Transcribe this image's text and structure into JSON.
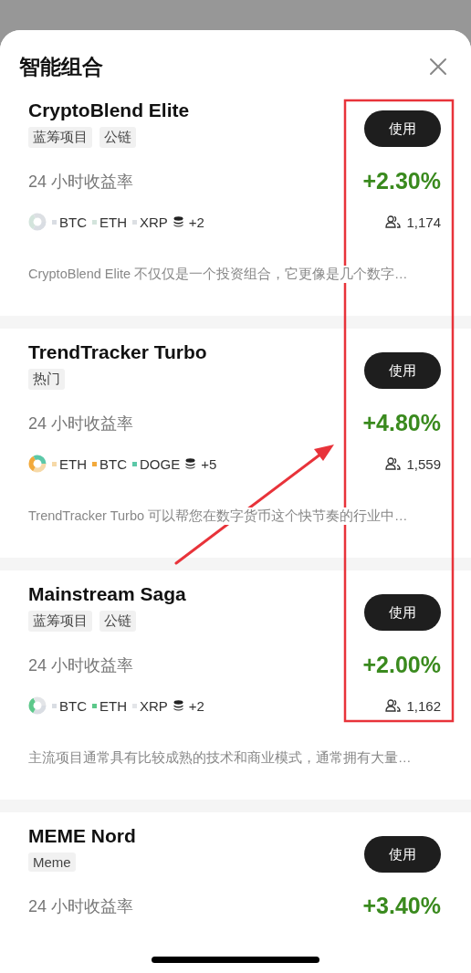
{
  "sheet": {
    "title": "智能组合"
  },
  "portfolios": [
    {
      "name": "CryptoBlend Elite",
      "tags": [
        "蓝筹项目",
        "公链"
      ],
      "button": "使用",
      "yield_label": "24 小时收益率",
      "yield": "+2.30%",
      "coins": [
        {
          "symbol": "BTC",
          "color": "#d9dde3"
        },
        {
          "symbol": "ETH",
          "color": "#d3e4dc"
        },
        {
          "symbol": "XRP",
          "color": "#dcdfe3"
        }
      ],
      "more": "+2",
      "users": "1,174",
      "description": "CryptoBlend Elite 不仅仅是一个投资组合，它更像是几个数字…"
    },
    {
      "name": "TrendTracker Turbo",
      "tags": [
        "热门"
      ],
      "button": "使用",
      "yield_label": "24 小时收益率",
      "yield": "+4.80%",
      "coins": [
        {
          "symbol": "ETH",
          "color": "#f6d9a8"
        },
        {
          "symbol": "BTC",
          "color": "#f2a93b"
        },
        {
          "symbol": "DOGE",
          "color": "#5cc8a8"
        }
      ],
      "more": "+5",
      "users": "1,559",
      "description": "TrendTracker Turbo 可以帮您在数字货币这个快节奏的行业中…"
    },
    {
      "name": "Mainstream Saga",
      "tags": [
        "蓝筹项目",
        "公链"
      ],
      "button": "使用",
      "yield_label": "24 小时收益率",
      "yield": "+2.00%",
      "coins": [
        {
          "symbol": "BTC",
          "color": "#d9dde3"
        },
        {
          "symbol": "ETH",
          "color": "#5cc88a"
        },
        {
          "symbol": "XRP",
          "color": "#e3e5e8"
        }
      ],
      "more": "+2",
      "users": "1,162",
      "description": "主流项目通常具有比较成熟的技术和商业模式，通常拥有大量…"
    },
    {
      "name": "MEME Nord",
      "tags": [
        "Meme"
      ],
      "button": "使用",
      "yield_label": "24 小时收益率",
      "yield": "+3.40%"
    }
  ]
}
